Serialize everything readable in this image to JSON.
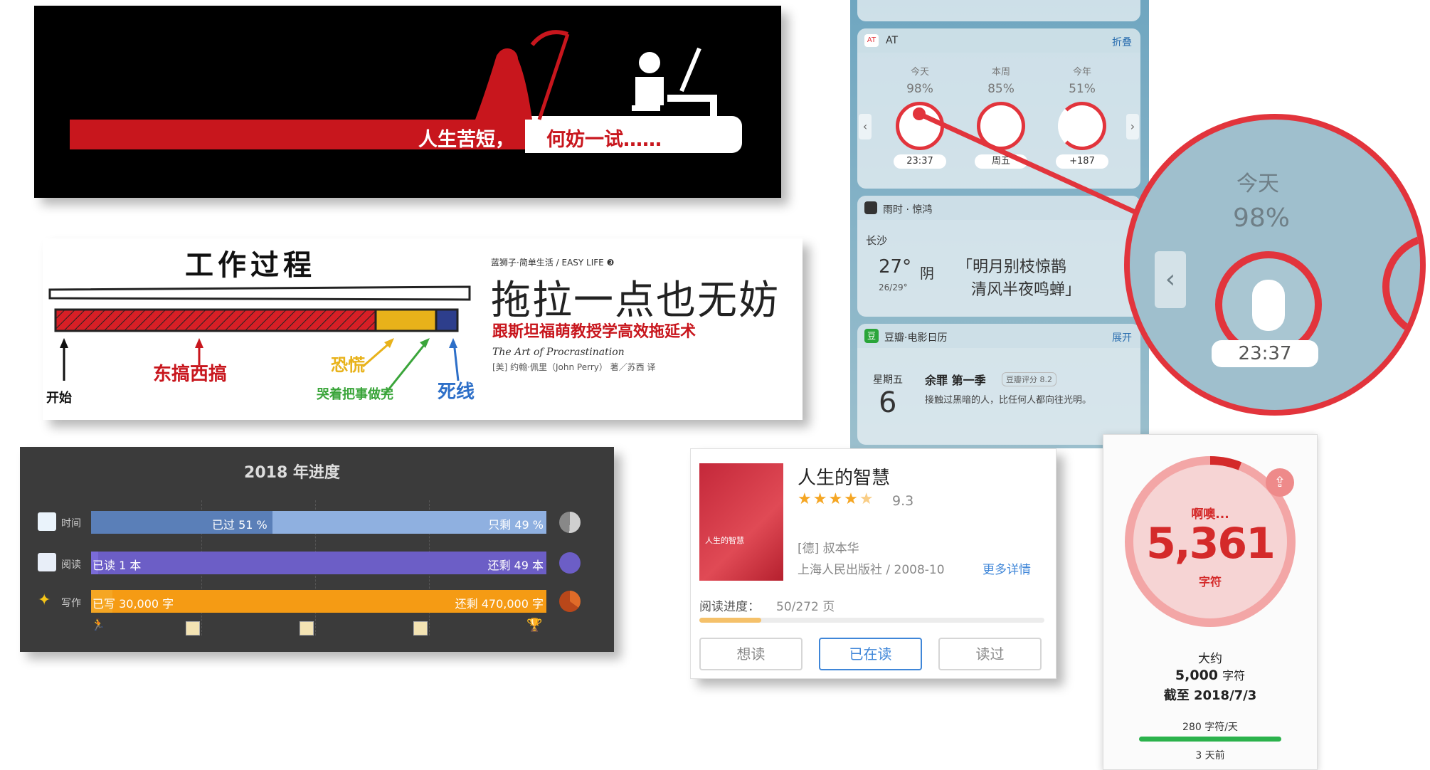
{
  "banner": {
    "slogan_left": "人生苦短，",
    "slogan_right": "何妨一试……"
  },
  "sketch": {
    "title": "工作过程",
    "start_label": "开始",
    "mess_label": "东搞西搞",
    "panic_label": "恐慌",
    "cry_label": "哭着把事做完",
    "deadline_label": "死线",
    "series": "蓝狮子·简单生活 / EASY LIFE ❸",
    "book_title": "拖拉一点也无妨",
    "book_subtitle": "跟斯坦福萌教授学高效拖延术",
    "english_title": "The Art of Procrastination",
    "authors": "[美] 约翰·佩里（John Perry） 著／苏西 译"
  },
  "progress_card": {
    "title": "2018 年进度",
    "rows": [
      {
        "label": "时间",
        "done": "已过 51 %",
        "remaining": "只剩 49 %",
        "fraction": 0.51,
        "done_color": "#5a7fb8",
        "rest_color": "#8fb0e0",
        "dot_color": "#cfcfcf"
      },
      {
        "label": "阅读",
        "done": "已读 1 本",
        "remaining": "还剩 49 本",
        "fraction": 0.02,
        "done_color": "#7a6bd8",
        "rest_color": "#6c5ec6",
        "dot_color": "#6c5ec6"
      },
      {
        "label": "写作",
        "done": "已写 30,000 字",
        "remaining": "还剩 470,000 字",
        "fraction": 0.06,
        "done_color": "#f5a623",
        "rest_color": "#f59b14",
        "dot_color": "#e06b28"
      }
    ],
    "colors": {
      "background": "#3b3b3b"
    }
  },
  "widgets": {
    "at": {
      "name": "AT",
      "collapse": "折叠",
      "columns": [
        {
          "period": "今天",
          "percent": "98%",
          "value": "23:37"
        },
        {
          "period": "本周",
          "percent": "85%",
          "value": "周五"
        },
        {
          "period": "今年",
          "percent": "51%",
          "value": "+187"
        }
      ]
    },
    "weather": {
      "name": "雨时 · 惊鸿",
      "city": "长沙",
      "temp": "27°",
      "condition": "阴",
      "range": "26/29°",
      "poem_line1": "「明月别枝惊鹊",
      "poem_line2": "清风半夜鸣蝉」"
    },
    "douban": {
      "name": "豆瓣·电影日历",
      "expand": "展开",
      "weekday": "星期五",
      "day": "6",
      "movie": "余罪 第一季",
      "rating": "豆瓣评分 8.2",
      "quote": "接触过黑暗的人，比任何人都向往光明。"
    }
  },
  "magnifier": {
    "period": "今天",
    "percent": "98%",
    "value": "23:37"
  },
  "book_card": {
    "title": "人生的智慧",
    "cover_text": "人生的智慧",
    "stars": 4.5,
    "score": "9.3",
    "author": "[德] 叔本华",
    "publisher": "上海人民出版社 / 2008-10",
    "more": "更多详情",
    "progress_label": "阅读进度：",
    "progress_value": "50/272 页",
    "progress_fraction": 0.184,
    "buttons": [
      "想读",
      "已在读",
      "读过"
    ]
  },
  "writer": {
    "exclaim": "啊噢...",
    "count": "5,361",
    "unit": "字符",
    "approx": "大约",
    "approx_value": "5,000",
    "approx_unit": "字符",
    "as_of": "截至 2018/7/3",
    "rate": "280 字符/天",
    "ago": "3 天前",
    "ring_fraction": 0.06
  }
}
